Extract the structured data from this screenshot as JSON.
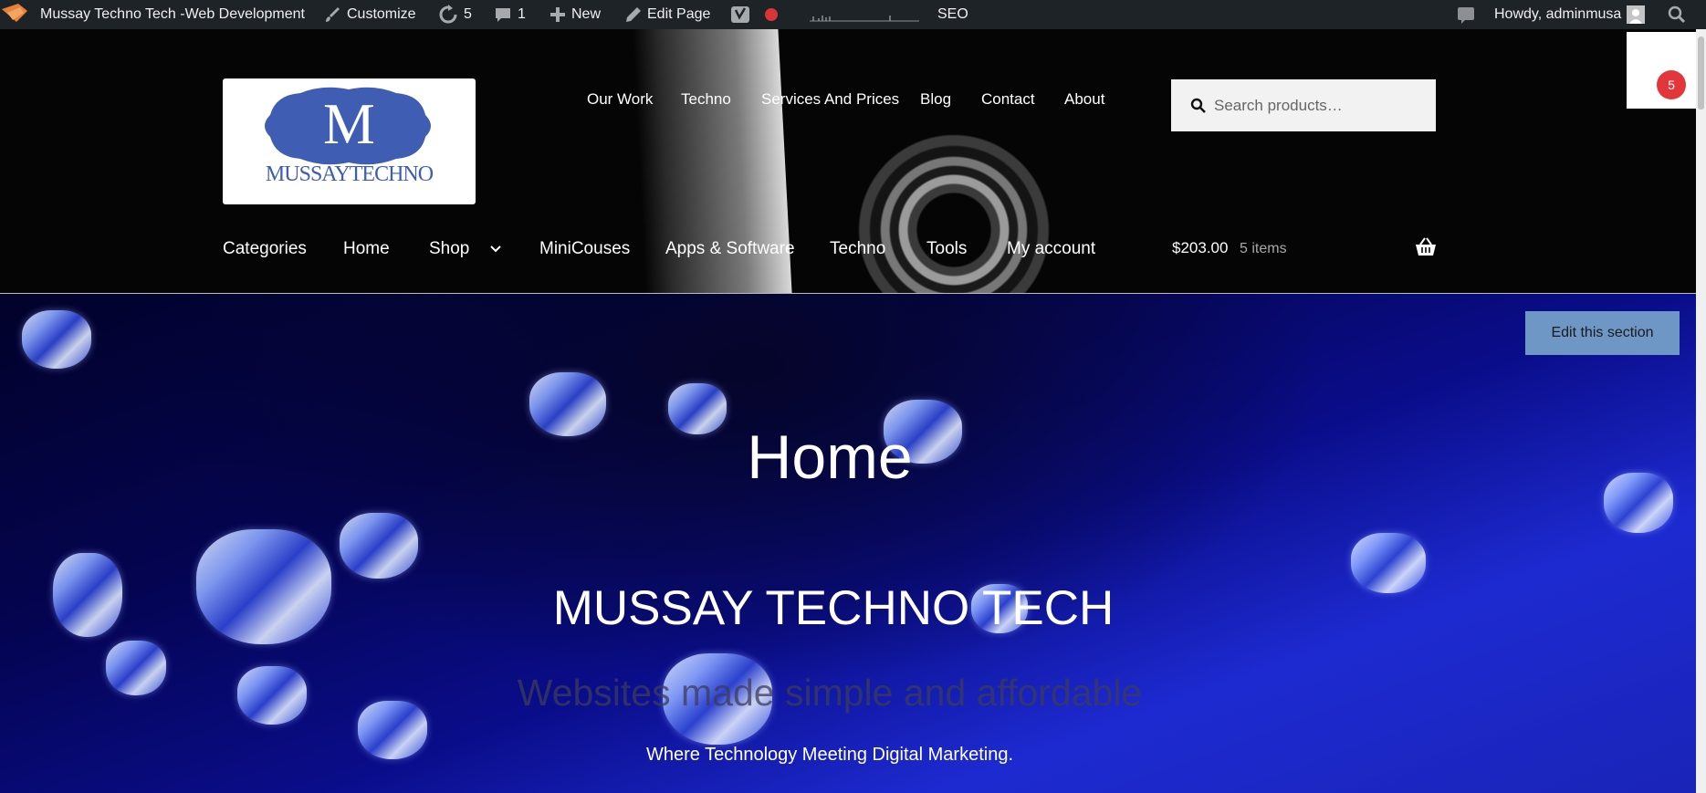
{
  "admin_bar": {
    "site_name": "Mussay Techno Tech -Web Development",
    "customize": "Customize",
    "updates_count": "5",
    "comments_count": "1",
    "new_label": "New",
    "edit_page": "Edit Page",
    "seo_label": "SEO",
    "greeting": "Howdy, adminmusa"
  },
  "logo": {
    "initial": "M",
    "wordmark": "MUSSAYTECHNO"
  },
  "top_nav": [
    "Our Work",
    "Techno",
    "Services And Prices",
    "Blog",
    "Contact",
    "About"
  ],
  "search": {
    "placeholder": "Search products…"
  },
  "main_nav": [
    "Categories",
    "Home",
    "Shop",
    "MiniCouses",
    "Apps & Software",
    "Techno",
    "Tools",
    "My account"
  ],
  "cart": {
    "total": "$203.00",
    "count": "5 items"
  },
  "side_badge": "5",
  "hero": {
    "edit_button": "Edit this section",
    "page_title": "Home",
    "brand": "MUSSAY TECHNO TECH",
    "tagline": "Websites made simple and affordable",
    "subtitle": "Where Technology Meeting Digital Marketing."
  },
  "colors": {
    "admin_bar": "#1d2327",
    "header_bg": "#050505",
    "badge_red": "#e2363b",
    "edit_button": "#6f97c6",
    "logo_blue": "#3f5db3"
  }
}
